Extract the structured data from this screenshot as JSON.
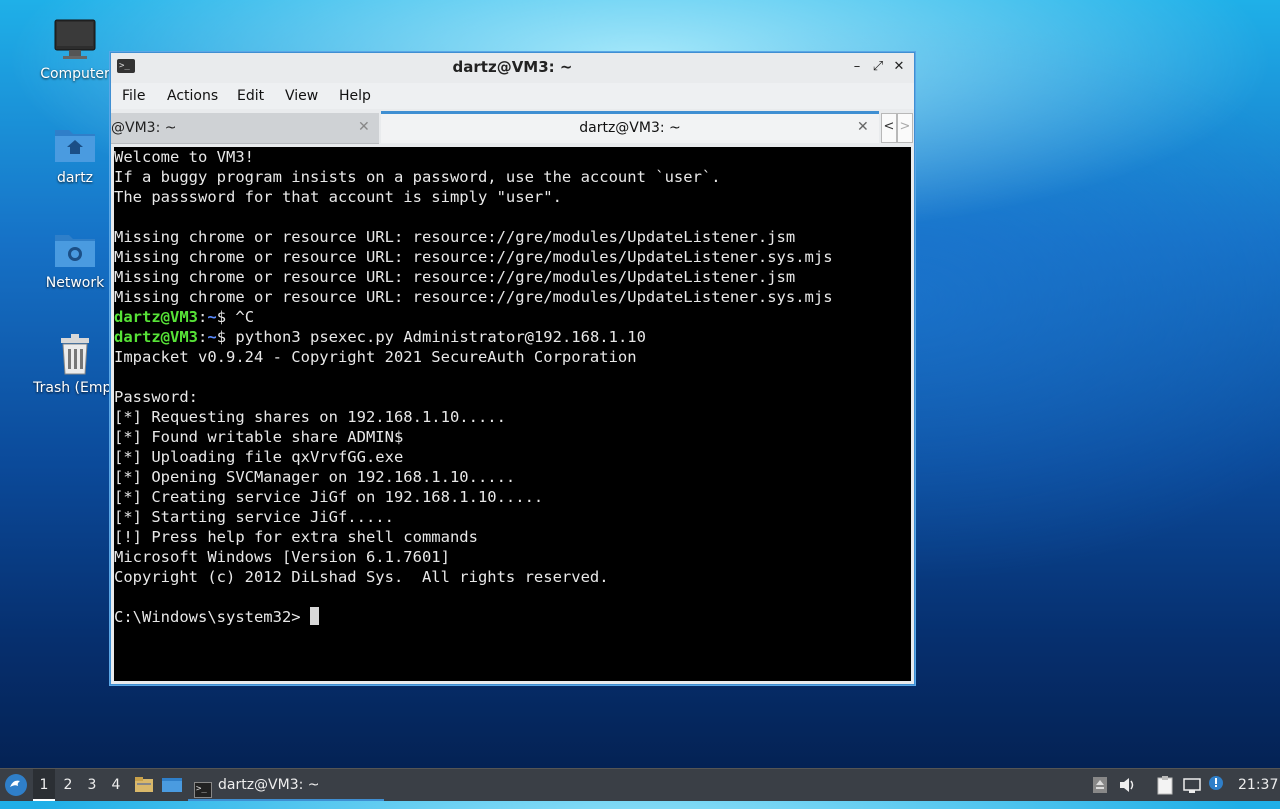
{
  "desktop": {
    "icons": [
      {
        "label": "Computer",
        "icon": "monitor-icon"
      },
      {
        "label": "dartz",
        "icon": "home-folder-icon"
      },
      {
        "label": "Network",
        "icon": "network-folder-icon"
      },
      {
        "label": "Trash (Empt",
        "icon": "trash-icon"
      }
    ]
  },
  "window": {
    "title": "dartz@VM3: ~",
    "controls": {
      "minimize": "–",
      "maximize": "⤢",
      "close": "✕"
    },
    "menu": [
      "File",
      "Actions",
      "Edit",
      "View",
      "Help"
    ],
    "tabs": [
      {
        "label": "@VM3: ~",
        "close": "✕"
      },
      {
        "label": "dartz@VM3: ~",
        "close": "✕"
      }
    ],
    "tab_nav": {
      "prev": "<",
      "next": ">"
    }
  },
  "terminal": {
    "lines": [
      "Welcome to VM3!",
      "If a buggy program insists on a password, use the account `user`.",
      "The passsword for that account is simply \"user\".",
      "",
      "Missing chrome or resource URL: resource://gre/modules/UpdateListener.jsm",
      "Missing chrome or resource URL: resource://gre/modules/UpdateListener.sys.mjs",
      "Missing chrome or resource URL: resource://gre/modules/UpdateListener.jsm",
      "Missing chrome or resource URL: resource://gre/modules/UpdateListener.sys.mjs"
    ],
    "prompt_user": "dartz@VM3",
    "prompt_sep": ":",
    "prompt_path": "~",
    "prompt_dollar": "$ ",
    "cmd1": "^C",
    "cmd2": "python3 psexec.py Administrator@192.168.1.10",
    "output": [
      "Impacket v0.9.24 - Copyright 2021 SecureAuth Corporation",
      "",
      "Password:",
      "[*] Requesting shares on 192.168.1.10.....",
      "[*] Found writable share ADMIN$",
      "[*] Uploading file qxVrvfGG.exe",
      "[*] Opening SVCManager on 192.168.1.10.....",
      "[*] Creating service JiGf on 192.168.1.10.....",
      "[*] Starting service JiGf.....",
      "[!] Press help for extra shell commands",
      "Microsoft Windows [Version 6.1.7601]",
      "Copyright (c) 2012 DiLshad Sys.  All rights reserved.",
      ""
    ],
    "win_prompt": "C:\\Windows\\system32> "
  },
  "taskbar": {
    "workspaces": [
      "1",
      "2",
      "3",
      "4"
    ],
    "active_workspace": "1",
    "task_label": "dartz@VM3: ~",
    "clock": "21:37",
    "tray_icons": [
      "eject-icon",
      "volume-icon",
      "clipboard-icon",
      "network-icon",
      "notification-icon"
    ]
  }
}
